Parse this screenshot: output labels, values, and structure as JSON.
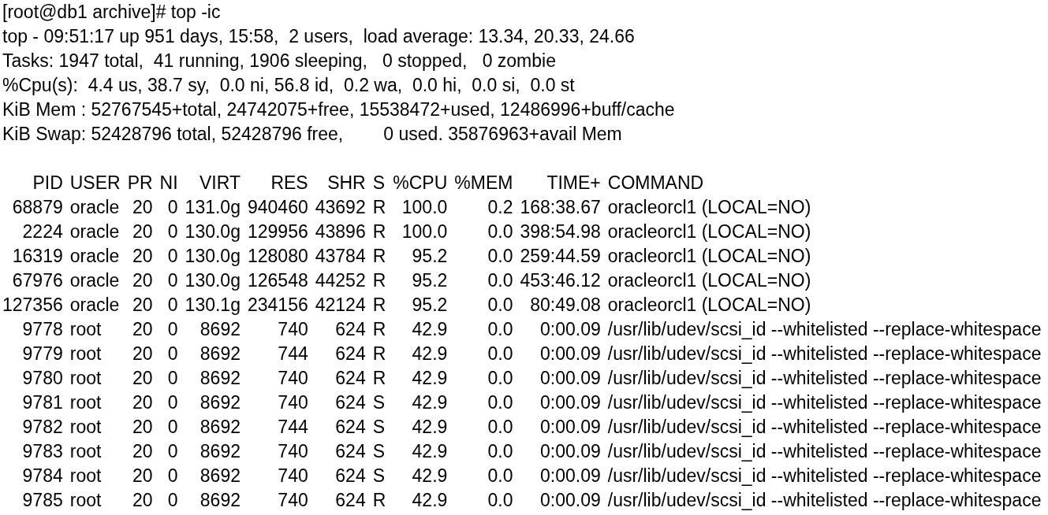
{
  "terminal": {
    "prompt": "[root@db1 archive]# top -ic",
    "summary": [
      "top - 09:51:17 up 951 days, 15:58,  2 users,  load average: 13.34, 20.33, 24.66",
      "Tasks: 1947 total,  41 running, 1906 sleeping,   0 stopped,   0 zombie",
      "%Cpu(s):  4.4 us, 38.7 sy,  0.0 ni, 56.8 id,  0.2 wa,  0.0 hi,  0.0 si,  0.0 st",
      "KiB Mem : 52767545+total, 24742075+free, 15538472+used, 12486996+buff/cache",
      "KiB Swap: 52428796 total, 52428796 free,        0 used. 35876963+avail Mem"
    ],
    "columns": [
      "PID",
      "USER",
      "PR",
      "NI",
      "VIRT",
      "RES",
      "SHR",
      "S",
      "%CPU",
      "%MEM",
      "TIME+",
      "COMMAND"
    ],
    "rows": [
      [
        "68879",
        "oracle",
        "20",
        "0",
        "131.0g",
        "940460",
        "43692",
        "R",
        "100.0",
        "0.2",
        "168:38.67",
        "oracleorcl1 (LOCAL=NO)"
      ],
      [
        "2224",
        "oracle",
        "20",
        "0",
        "130.0g",
        "129956",
        "43896",
        "R",
        "100.0",
        "0.0",
        "398:54.98",
        "oracleorcl1 (LOCAL=NO)"
      ],
      [
        "16319",
        "oracle",
        "20",
        "0",
        "130.0g",
        "128080",
        "43784",
        "R",
        "95.2",
        "0.0",
        "259:44.59",
        "oracleorcl1 (LOCAL=NO)"
      ],
      [
        "67976",
        "oracle",
        "20",
        "0",
        "130.0g",
        "126548",
        "44252",
        "R",
        "95.2",
        "0.0",
        "453:46.12",
        "oracleorcl1 (LOCAL=NO)"
      ],
      [
        "127356",
        "oracle",
        "20",
        "0",
        "130.1g",
        "234156",
        "42124",
        "R",
        "95.2",
        "0.0",
        "80:49.08",
        "oracleorcl1 (LOCAL=NO)"
      ],
      [
        "9778",
        "root",
        "20",
        "0",
        "8692",
        "740",
        "624",
        "R",
        "42.9",
        "0.0",
        "0:00.09",
        "/usr/lib/udev/scsi_id --whitelisted --replace-whitespace"
      ],
      [
        "9779",
        "root",
        "20",
        "0",
        "8692",
        "744",
        "624",
        "R",
        "42.9",
        "0.0",
        "0:00.09",
        "/usr/lib/udev/scsi_id --whitelisted --replace-whitespace"
      ],
      [
        "9780",
        "root",
        "20",
        "0",
        "8692",
        "740",
        "624",
        "R",
        "42.9",
        "0.0",
        "0:00.09",
        "/usr/lib/udev/scsi_id --whitelisted --replace-whitespace"
      ],
      [
        "9781",
        "root",
        "20",
        "0",
        "8692",
        "740",
        "624",
        "S",
        "42.9",
        "0.0",
        "0:00.09",
        "/usr/lib/udev/scsi_id --whitelisted --replace-whitespace"
      ],
      [
        "9782",
        "root",
        "20",
        "0",
        "8692",
        "744",
        "624",
        "S",
        "42.9",
        "0.0",
        "0:00.09",
        "/usr/lib/udev/scsi_id --whitelisted --replace-whitespace"
      ],
      [
        "9783",
        "root",
        "20",
        "0",
        "8692",
        "740",
        "624",
        "S",
        "42.9",
        "0.0",
        "0:00.09",
        "/usr/lib/udev/scsi_id --whitelisted --replace-whitespace"
      ],
      [
        "9784",
        "root",
        "20",
        "0",
        "8692",
        "740",
        "624",
        "S",
        "42.9",
        "0.0",
        "0:00.09",
        "/usr/lib/udev/scsi_id --whitelisted --replace-whitespace"
      ],
      [
        "9785",
        "root",
        "20",
        "0",
        "8692",
        "740",
        "624",
        "R",
        "42.9",
        "0.0",
        "0:00.09",
        "/usr/lib/udev/scsi_id --whitelisted --replace-whitespace"
      ]
    ]
  }
}
